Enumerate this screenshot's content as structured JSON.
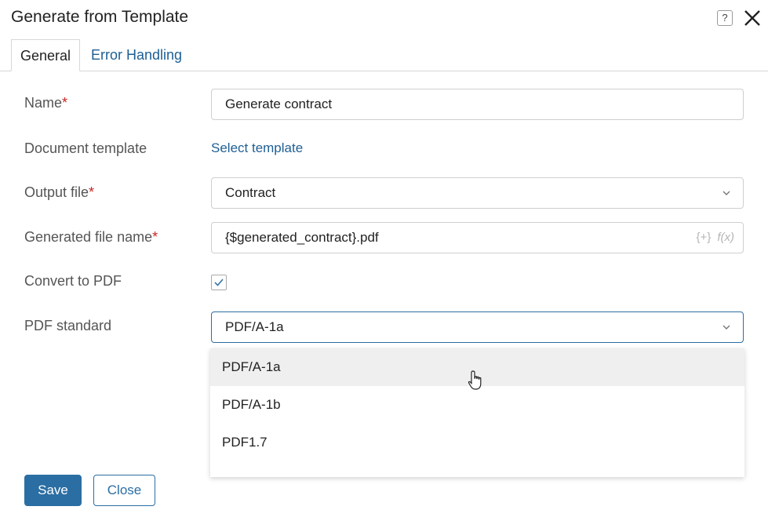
{
  "dialog": {
    "title": "Generate from Template",
    "help_icon": "question-mark-icon",
    "close_icon": "close-x-icon"
  },
  "tabs": [
    {
      "label": "General",
      "active": true
    },
    {
      "label": "Error Handling",
      "active": false
    }
  ],
  "form": {
    "name": {
      "label": "Name",
      "required": "*",
      "value": "Generate contract"
    },
    "document_template": {
      "label": "Document template",
      "link": "Select template"
    },
    "output_file": {
      "label": "Output file",
      "required": "*",
      "value": "Contract"
    },
    "generated_file_name": {
      "label": "Generated file name",
      "required": "*",
      "value": "{$generated_contract}.pdf",
      "icons": [
        "{+}",
        "f(x)"
      ]
    },
    "convert_to_pdf": {
      "label": "Convert to PDF",
      "checked": true
    },
    "pdf_standard": {
      "label": "PDF standard",
      "value": "PDF/A-1a"
    }
  },
  "dropdown": {
    "options": [
      "PDF/A-1a",
      "PDF/A-1b",
      "PDF1.7"
    ],
    "hovered": "PDF/A-1a"
  },
  "buttons": {
    "save": "Save",
    "close": "Close"
  },
  "colors": {
    "accent": "#2b6ea3",
    "link": "#1e5f94",
    "required": "#cc2222"
  }
}
